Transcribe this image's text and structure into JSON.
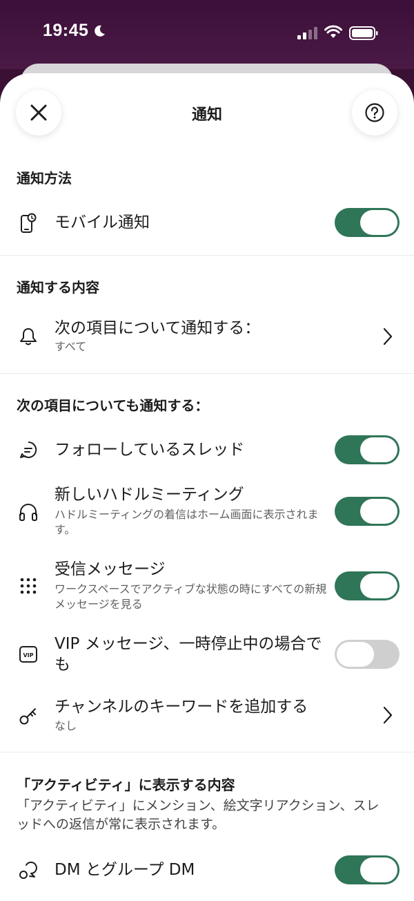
{
  "status_bar": {
    "time": "19:45",
    "icons": [
      "moon-icon",
      "signal-icon",
      "wifi-icon",
      "battery-icon"
    ]
  },
  "header": {
    "title": "通知",
    "close_icon": "close-icon",
    "help_icon": "help-icon"
  },
  "colors": {
    "toggle_on": "#2f7558",
    "toggle_off": "#cfcfcf",
    "status_bar_bg": "#3b0f39"
  },
  "sections": {
    "method": {
      "title": "通知方法",
      "mobile": {
        "label": "モバイル通知",
        "icon": "mobile-notification-icon",
        "enabled": true
      }
    },
    "content": {
      "title": "通知する内容",
      "notify_about": {
        "label": "次の項目について通知する：",
        "value": "すべて",
        "icon": "bell-icon"
      }
    },
    "also": {
      "title": "次の項目についても通知する：",
      "threads": {
        "label": "フォローしているスレッド",
        "icon": "thread-icon",
        "enabled": true
      },
      "huddles": {
        "label": "新しいハドルミーティング",
        "sub": "ハドルミーティングの着信はホーム画面に表示されます。",
        "icon": "headphones-icon",
        "enabled": true
      },
      "incoming": {
        "label": "受信メッセージ",
        "sub": "ワークスペースでアクティブな状態の時にすべての新規メッセージを見る",
        "icon": "grid-dots-icon",
        "enabled": true
      },
      "vip": {
        "label": "VIP メッセージ、一時停止中の場合でも",
        "icon": "vip-icon",
        "enabled": false
      },
      "keywords": {
        "label": "チャンネルのキーワードを追加する",
        "value": "なし",
        "icon": "key-icon"
      }
    },
    "activity": {
      "title": "「アクティビティ」に表示する内容",
      "description": "「アクティビティ」にメンション、絵文字リアクション、スレッドへの返信が常に表示されます。",
      "dm": {
        "label": "DM とグループ DM",
        "icon": "dm-icon",
        "enabled": true
      }
    }
  }
}
